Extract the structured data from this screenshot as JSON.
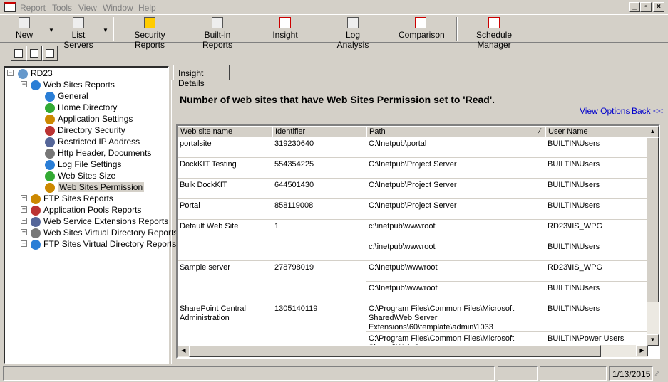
{
  "menu": [
    "Report",
    "Tools",
    "View",
    "Window",
    "Help"
  ],
  "toolbar": [
    {
      "label": "New",
      "icon": "new-server-icon"
    },
    {
      "label": "List Servers",
      "icon": "servers-icon"
    },
    {
      "label": "Security Reports",
      "icon": "security-key-icon"
    },
    {
      "label": "Built-in Reports",
      "icon": "reports-icon"
    },
    {
      "label": "Insight",
      "icon": "insight-icon"
    },
    {
      "label": "Log Analysis",
      "icon": "log-analysis-icon"
    },
    {
      "label": "Comparison",
      "icon": "comparison-icon"
    },
    {
      "label": "Schedule Manager",
      "icon": "schedule-icon"
    }
  ],
  "small_toolbar": [
    "print-icon",
    "print-preview-icon",
    "checklist-icon"
  ],
  "tree": {
    "root": "RD23",
    "group": "Web Sites Reports",
    "children": [
      "General",
      "Home Directory",
      "Application Settings",
      "Directory Security",
      "Restricted IP Address",
      "Http Header, Documents",
      "Log File Settings",
      "Web Sites Size",
      "Web Sites Permission"
    ],
    "selected": "Web Sites Permission",
    "others": [
      "FTP Sites Reports",
      "Application Pools Reports",
      "Web Service Extensions Reports",
      "Web Sites Virtual Directory Reports",
      "FTP Sites Virtual Directory Reports"
    ]
  },
  "tab": "Insight Details",
  "heading": "Number of web sites that have Web Sites Permission set to 'Read'.",
  "links": {
    "view_options": "View Options",
    "back": "Back <<"
  },
  "table": {
    "columns": [
      "Web site name",
      "Identifier",
      "Path",
      "User Name"
    ],
    "rows": [
      {
        "name": "portalsite",
        "id": "319230640",
        "entries": [
          [
            "C:\\Inetpub\\portal",
            "BUILTIN\\Users"
          ]
        ]
      },
      {
        "name": "DockKIT Testing",
        "id": "554354225",
        "entries": [
          [
            "C:\\Inetpub\\Project Server",
            "BUILTIN\\Users"
          ]
        ]
      },
      {
        "name": "Bulk DockKIT",
        "id": "644501430",
        "entries": [
          [
            "C:\\Inetpub\\Project Server",
            "BUILTIN\\Users"
          ]
        ]
      },
      {
        "name": "Portal",
        "id": "858119008",
        "entries": [
          [
            "C:\\Inetpub\\Project Server",
            "BUILTIN\\Users"
          ]
        ]
      },
      {
        "name": "Default Web Site",
        "id": "1",
        "entries": [
          [
            "c:\\inetpub\\wwwroot",
            "RD23\\IIS_WPG"
          ],
          [
            "c:\\inetpub\\wwwroot",
            "BUILTIN\\Users"
          ]
        ]
      },
      {
        "name": "Sample server",
        "id": "278798019",
        "entries": [
          [
            "C:\\Inetpub\\wwwroot",
            "RD23\\IIS_WPG"
          ],
          [
            "C:\\Inetpub\\wwwroot",
            "BUILTIN\\Users"
          ]
        ]
      },
      {
        "name": "SharePoint Central Administration",
        "id": "1305140119",
        "entries": [
          [
            "C:\\Program Files\\Common Files\\Microsoft Shared\\Web Server Extensions\\60\\template\\admin\\1033",
            "BUILTIN\\Users"
          ],
          [
            "C:\\Program Files\\Common Files\\Microsoft Shared\\Web Server",
            "BUILTIN\\Power Users"
          ]
        ]
      }
    ]
  },
  "status": {
    "date": "1/13/2015"
  }
}
